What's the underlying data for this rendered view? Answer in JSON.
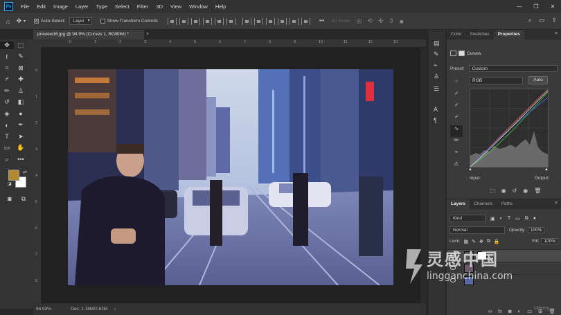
{
  "app": {
    "logo": "Ps"
  },
  "menu": [
    "File",
    "Edit",
    "Image",
    "Layer",
    "Type",
    "Select",
    "Filter",
    "3D",
    "View",
    "Window",
    "Help"
  ],
  "window_controls": {
    "minimize": "—",
    "restore": "❐",
    "close": "✕"
  },
  "options_bar": {
    "auto_select_label": "Auto-Select:",
    "auto_select_checked": true,
    "target_value": "Layer",
    "show_transform_label": "Show Transform Controls",
    "mode_3d_label": "3D Mode:"
  },
  "document": {
    "tab_title": "preview16.jpg @ 94.9% (Curves 1, RGB/8#) *",
    "close_glyph": "×"
  },
  "rulers": {
    "top": [
      "0",
      "1",
      "2",
      "3",
      "4",
      "5",
      "6",
      "7",
      "8",
      "9",
      "10",
      "11",
      "12",
      "13"
    ],
    "left": [
      "0",
      "1",
      "2",
      "3",
      "4",
      "5",
      "6",
      "7",
      "8"
    ]
  },
  "status": {
    "zoom": "94.93%",
    "doc": "Doc: 1.16M/2.62M",
    "arrow": "›"
  },
  "colors": {
    "foreground": "#b38a2e",
    "background": "#ffffff",
    "accent": "#31a8ff"
  },
  "properties_panel": {
    "tabs": [
      "Color",
      "Swatches",
      "Properties"
    ],
    "active_tab": "Properties",
    "adjustment": "Curves",
    "preset_label": "Preset:",
    "preset_value": "Custom",
    "channel": "RGB",
    "auto_label": "Auto",
    "input_label": "Input:",
    "output_label": "Output:"
  },
  "layers_panel": {
    "tabs": [
      "Layers",
      "Channels",
      "Paths"
    ],
    "active_tab": "Layers",
    "kind_value": "Kind",
    "blend_mode": "Normal",
    "opacity_label": "Opacity:",
    "opacity_value": "100%",
    "lock_label": "Lock:",
    "fill_label": "Fill:",
    "fill_value": "100%"
  },
  "watermark": {
    "text": "灵感中国",
    "url": "lingganchina.com",
    "corner": "Udemy"
  }
}
